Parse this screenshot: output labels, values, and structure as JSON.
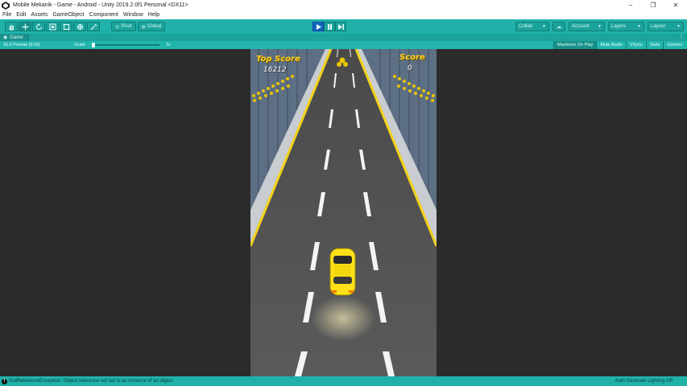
{
  "window": {
    "title": "Mobile Mekanik - Game - Android - Unity 2019.2.0f1 Personal <DX11>",
    "controls": [
      "–",
      "❐",
      "✕"
    ]
  },
  "menu": [
    "File",
    "Edit",
    "Assets",
    "GameObject",
    "Component",
    "Window",
    "Help"
  ],
  "toolbar": {
    "tools": [
      "hand-tool",
      "move-tool",
      "rotate-tool",
      "scale-tool",
      "rect-tool",
      "transform-tool",
      "custom-tool"
    ],
    "pivot_label": "Pivot",
    "global_label": "Global",
    "collab_label": "Collab",
    "account_label": "Account",
    "layers_label": "Layers",
    "layout_label": "Layout"
  },
  "game_tab": {
    "label": "Game"
  },
  "game_toolbar": {
    "aspect": "16:9 Portrait (9:16)",
    "scale_label": "Scale",
    "scale_value": "1x",
    "maximize_label": "Maximize On Play",
    "mute_label": "Mute Audio",
    "vsync_label": "VSync",
    "stats_label": "Stats",
    "gizmos_label": "Gizmos"
  },
  "hud": {
    "top_score_label": "Top Score",
    "top_score_value": "16212",
    "score_label": "Score",
    "score_value": "0"
  },
  "status": {
    "message": "NullReferenceException: Object reference not set to an instance of an object",
    "right": "Auto Generate Lighting Off"
  },
  "colors": {
    "accent": "#20b2aa",
    "hud_label": "#ffd21f",
    "car": "#ffe11a"
  }
}
